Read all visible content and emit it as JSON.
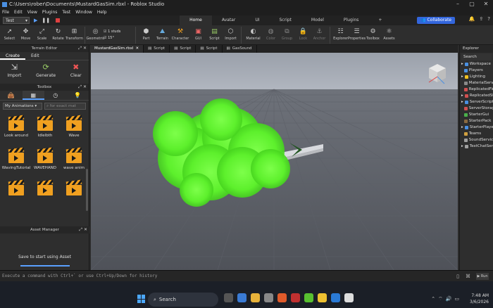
{
  "window": {
    "title": "C:\\Users\\rober\\Documents\\MustardGasSim.rbxl - Roblox Studio",
    "controls": [
      "–",
      "▢",
      "✕"
    ]
  },
  "menu": [
    "File",
    "Edit",
    "View",
    "Plugins",
    "Test",
    "Window",
    "Help"
  ],
  "test_selector": "Test",
  "ribbon_tabs": [
    "Home",
    "Avatar",
    "UI",
    "Script",
    "Model",
    "Plugins",
    "+"
  ],
  "collaborate_label": "Collaborate",
  "tools": [
    {
      "label": "Select",
      "icon": "cursor-icon"
    },
    {
      "label": "Move",
      "icon": "move-icon"
    },
    {
      "label": "Scale",
      "icon": "scale-icon"
    },
    {
      "label": "Rotate",
      "icon": "rotate-icon"
    },
    {
      "label": "Transform",
      "icon": "transform-icon"
    },
    {
      "label": "Geometric",
      "icon": "geometric-icon"
    }
  ],
  "snap": {
    "move": "1 studs",
    "rotate": "15°"
  },
  "tools2": [
    {
      "label": "Part",
      "icon": "part-icon"
    },
    {
      "label": "Terrain",
      "icon": "terrain-icon"
    },
    {
      "label": "Character",
      "icon": "character-icon"
    },
    {
      "label": "GUI",
      "icon": "gui-icon"
    },
    {
      "label": "Script",
      "icon": "script-icon"
    },
    {
      "label": "Import",
      "icon": "import-icon"
    },
    {
      "label": "Material",
      "icon": "material-icon"
    },
    {
      "label": "Color",
      "icon": "color-icon"
    },
    {
      "label": "Group",
      "icon": "group-icon"
    },
    {
      "label": "Lock",
      "icon": "lock-icon"
    },
    {
      "label": "Anchor",
      "icon": "anchor-icon"
    },
    {
      "label": "Explorer",
      "icon": "explorer-icon"
    },
    {
      "label": "Properties",
      "icon": "properties-icon"
    },
    {
      "label": "Toolbox",
      "icon": "toolbox-icon"
    },
    {
      "label": "Assets",
      "icon": "assets-icon"
    }
  ],
  "terrain_editor": {
    "title": "Terrain Editor",
    "tabs": [
      "Create",
      "Edit"
    ],
    "buttons": [
      "Import",
      "Generate",
      "Clear"
    ]
  },
  "toolbox": {
    "title": "Toolbox",
    "category": "My Animations",
    "search_placeholder": "for exact mat",
    "items": [
      "Look around",
      "Idlelbth",
      "Wave",
      "WavingTutorial",
      "WAVEHAND",
      "wave anim",
      "",
      "",
      ""
    ]
  },
  "asset_manager": {
    "title": "Asset Manager",
    "message": "Save to start using Asset"
  },
  "doc_tabs": [
    "MustardGasSim.rbxl",
    "Script",
    "Script",
    "Script",
    "GasSound"
  ],
  "explorer": {
    "title": "Explorer",
    "search": "Search",
    "items": [
      {
        "name": "Workspace",
        "color": "#4a90e2"
      },
      {
        "name": "Players",
        "color": "#4a90e2"
      },
      {
        "name": "Lighting",
        "color": "#f0c020"
      },
      {
        "name": "MaterialService",
        "color": "#8a8a8a"
      },
      {
        "name": "ReplicatedFirst",
        "color": "#d05050"
      },
      {
        "name": "ReplicatedStorage",
        "color": "#d05050"
      },
      {
        "name": "ServerScriptService",
        "color": "#4a90e2"
      },
      {
        "name": "ServerStorage",
        "color": "#d05050"
      },
      {
        "name": "StarterGui",
        "color": "#4ab04a"
      },
      {
        "name": "StarterPack",
        "color": "#8a6a40"
      },
      {
        "name": "StarterPlayer",
        "color": "#4a90e2"
      },
      {
        "name": "Teams",
        "color": "#d0a040"
      },
      {
        "name": "SoundService",
        "color": "#a0a0a0"
      },
      {
        "name": "TextChatService",
        "color": "#a0a0a0"
      }
    ]
  },
  "command_bar": {
    "placeholder": "Execute a command with Ctrl+` or use Ctrl+Up/Down for history",
    "run_label": "Run"
  },
  "taskbar": {
    "search_label": "Search",
    "time": "7:48 AM",
    "date": "3/6/2026"
  },
  "colors": {
    "accent": "#3366dd",
    "smoke": "#66ff33"
  }
}
